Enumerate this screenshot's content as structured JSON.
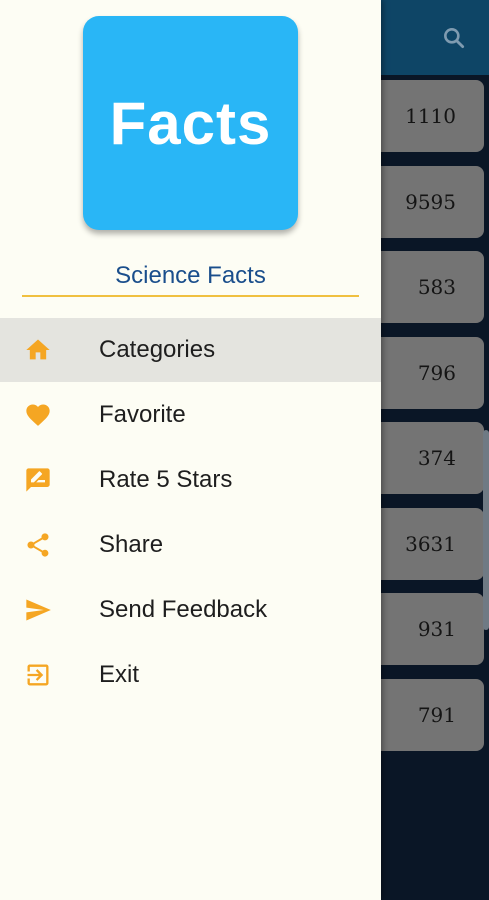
{
  "drawer": {
    "logo_text": "Facts",
    "app_name": "Science Facts",
    "menu": [
      {
        "label": "Categories",
        "icon": "home-icon",
        "active": true
      },
      {
        "label": "Favorite",
        "icon": "heart-icon",
        "active": false
      },
      {
        "label": "Rate 5 Stars",
        "icon": "rate-review-icon",
        "active": false
      },
      {
        "label": "Share",
        "icon": "share-icon",
        "active": false
      },
      {
        "label": "Send Feedback",
        "icon": "send-icon",
        "active": false
      },
      {
        "label": "Exit",
        "icon": "exit-icon",
        "active": false
      }
    ]
  },
  "background_list": {
    "counts": [
      "1110",
      "9595",
      "583",
      "796",
      "374",
      "3631",
      "931",
      "791"
    ]
  },
  "colors": {
    "accent": "#f5a623",
    "logo_bg": "#29b6f6",
    "app_name": "#1a4e8c",
    "divider": "#f0c040",
    "toolbar": "#0e4566"
  }
}
